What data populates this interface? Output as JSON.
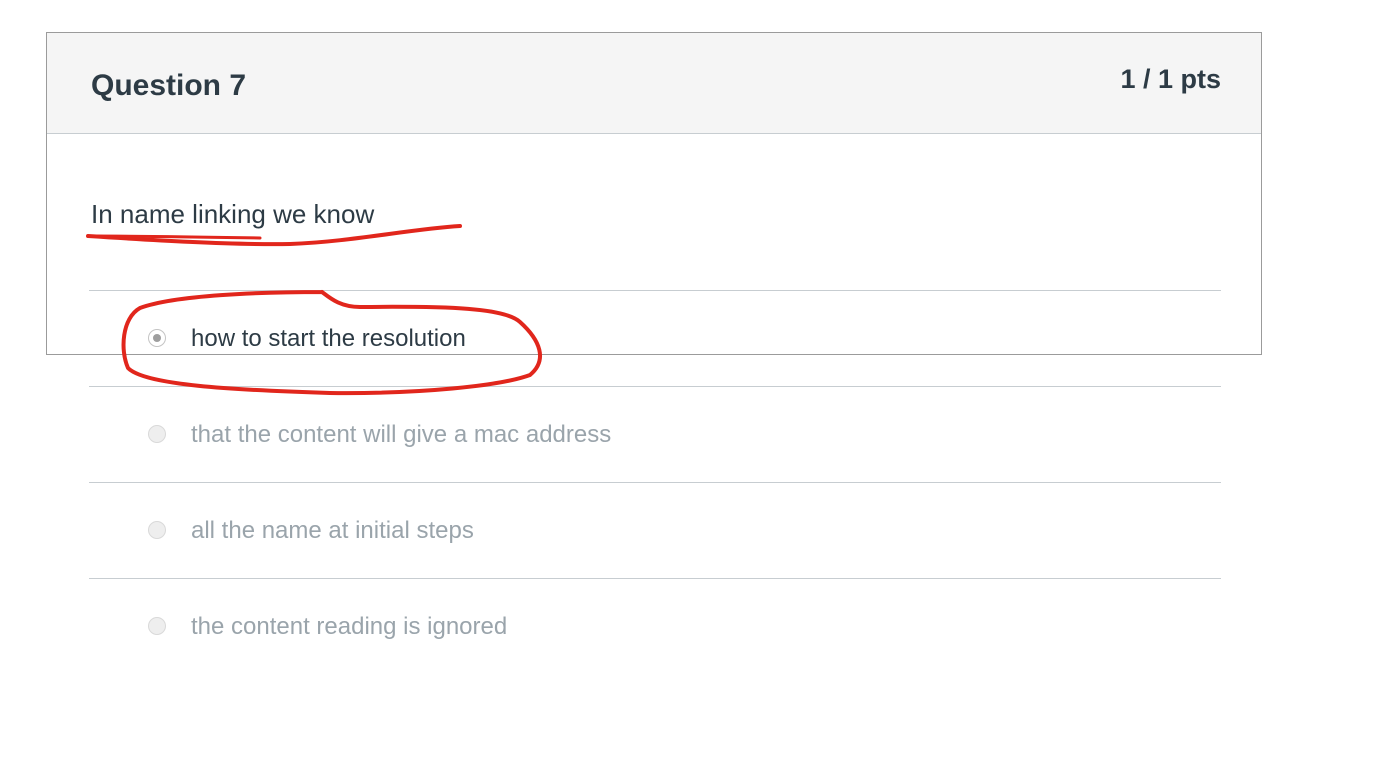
{
  "question": {
    "title": "Question 7",
    "points": "1 / 1 pts",
    "text": "In name linking we know"
  },
  "answers": [
    {
      "label": "how to start the resolution",
      "selected": true
    },
    {
      "label": "that the content will give a mac address",
      "selected": false
    },
    {
      "label": "all the name at initial steps",
      "selected": false
    },
    {
      "label": "the content reading is ignored",
      "selected": false
    }
  ],
  "colors": {
    "annotation": "#e1261c",
    "header_bg": "#f5f5f5",
    "text_dark": "#2d3b45",
    "text_muted": "#9aa4ab"
  }
}
